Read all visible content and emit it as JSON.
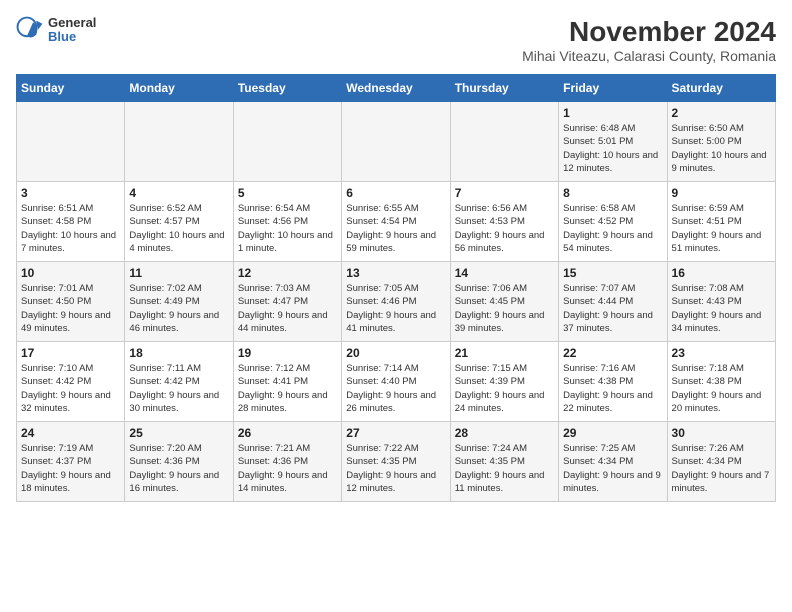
{
  "logo": {
    "general": "General",
    "blue": "Blue"
  },
  "title": "November 2024",
  "subtitle": "Mihai Viteazu, Calarasi County, Romania",
  "headers": [
    "Sunday",
    "Monday",
    "Tuesday",
    "Wednesday",
    "Thursday",
    "Friday",
    "Saturday"
  ],
  "weeks": [
    [
      {
        "day": "",
        "info": ""
      },
      {
        "day": "",
        "info": ""
      },
      {
        "day": "",
        "info": ""
      },
      {
        "day": "",
        "info": ""
      },
      {
        "day": "",
        "info": ""
      },
      {
        "day": "1",
        "info": "Sunrise: 6:48 AM\nSunset: 5:01 PM\nDaylight: 10 hours and 12 minutes."
      },
      {
        "day": "2",
        "info": "Sunrise: 6:50 AM\nSunset: 5:00 PM\nDaylight: 10 hours and 9 minutes."
      }
    ],
    [
      {
        "day": "3",
        "info": "Sunrise: 6:51 AM\nSunset: 4:58 PM\nDaylight: 10 hours and 7 minutes."
      },
      {
        "day": "4",
        "info": "Sunrise: 6:52 AM\nSunset: 4:57 PM\nDaylight: 10 hours and 4 minutes."
      },
      {
        "day": "5",
        "info": "Sunrise: 6:54 AM\nSunset: 4:56 PM\nDaylight: 10 hours and 1 minute."
      },
      {
        "day": "6",
        "info": "Sunrise: 6:55 AM\nSunset: 4:54 PM\nDaylight: 9 hours and 59 minutes."
      },
      {
        "day": "7",
        "info": "Sunrise: 6:56 AM\nSunset: 4:53 PM\nDaylight: 9 hours and 56 minutes."
      },
      {
        "day": "8",
        "info": "Sunrise: 6:58 AM\nSunset: 4:52 PM\nDaylight: 9 hours and 54 minutes."
      },
      {
        "day": "9",
        "info": "Sunrise: 6:59 AM\nSunset: 4:51 PM\nDaylight: 9 hours and 51 minutes."
      }
    ],
    [
      {
        "day": "10",
        "info": "Sunrise: 7:01 AM\nSunset: 4:50 PM\nDaylight: 9 hours and 49 minutes."
      },
      {
        "day": "11",
        "info": "Sunrise: 7:02 AM\nSunset: 4:49 PM\nDaylight: 9 hours and 46 minutes."
      },
      {
        "day": "12",
        "info": "Sunrise: 7:03 AM\nSunset: 4:47 PM\nDaylight: 9 hours and 44 minutes."
      },
      {
        "day": "13",
        "info": "Sunrise: 7:05 AM\nSunset: 4:46 PM\nDaylight: 9 hours and 41 minutes."
      },
      {
        "day": "14",
        "info": "Sunrise: 7:06 AM\nSunset: 4:45 PM\nDaylight: 9 hours and 39 minutes."
      },
      {
        "day": "15",
        "info": "Sunrise: 7:07 AM\nSunset: 4:44 PM\nDaylight: 9 hours and 37 minutes."
      },
      {
        "day": "16",
        "info": "Sunrise: 7:08 AM\nSunset: 4:43 PM\nDaylight: 9 hours and 34 minutes."
      }
    ],
    [
      {
        "day": "17",
        "info": "Sunrise: 7:10 AM\nSunset: 4:42 PM\nDaylight: 9 hours and 32 minutes."
      },
      {
        "day": "18",
        "info": "Sunrise: 7:11 AM\nSunset: 4:42 PM\nDaylight: 9 hours and 30 minutes."
      },
      {
        "day": "19",
        "info": "Sunrise: 7:12 AM\nSunset: 4:41 PM\nDaylight: 9 hours and 28 minutes."
      },
      {
        "day": "20",
        "info": "Sunrise: 7:14 AM\nSunset: 4:40 PM\nDaylight: 9 hours and 26 minutes."
      },
      {
        "day": "21",
        "info": "Sunrise: 7:15 AM\nSunset: 4:39 PM\nDaylight: 9 hours and 24 minutes."
      },
      {
        "day": "22",
        "info": "Sunrise: 7:16 AM\nSunset: 4:38 PM\nDaylight: 9 hours and 22 minutes."
      },
      {
        "day": "23",
        "info": "Sunrise: 7:18 AM\nSunset: 4:38 PM\nDaylight: 9 hours and 20 minutes."
      }
    ],
    [
      {
        "day": "24",
        "info": "Sunrise: 7:19 AM\nSunset: 4:37 PM\nDaylight: 9 hours and 18 minutes."
      },
      {
        "day": "25",
        "info": "Sunrise: 7:20 AM\nSunset: 4:36 PM\nDaylight: 9 hours and 16 minutes."
      },
      {
        "day": "26",
        "info": "Sunrise: 7:21 AM\nSunset: 4:36 PM\nDaylight: 9 hours and 14 minutes."
      },
      {
        "day": "27",
        "info": "Sunrise: 7:22 AM\nSunset: 4:35 PM\nDaylight: 9 hours and 12 minutes."
      },
      {
        "day": "28",
        "info": "Sunrise: 7:24 AM\nSunset: 4:35 PM\nDaylight: 9 hours and 11 minutes."
      },
      {
        "day": "29",
        "info": "Sunrise: 7:25 AM\nSunset: 4:34 PM\nDaylight: 9 hours and 9 minutes."
      },
      {
        "day": "30",
        "info": "Sunrise: 7:26 AM\nSunset: 4:34 PM\nDaylight: 9 hours and 7 minutes."
      }
    ]
  ]
}
